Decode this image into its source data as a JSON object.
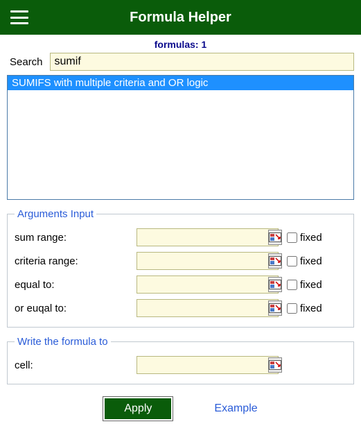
{
  "header": {
    "title": "Formula Helper"
  },
  "subheader": {
    "text": "formulas: 1"
  },
  "search": {
    "label": "Search",
    "value": "sumif"
  },
  "results": [
    {
      "label": "SUMIFS with multiple criteria and OR logic"
    }
  ],
  "arguments": {
    "legend": "Arguments Input",
    "rows": [
      {
        "label": "sum range:",
        "value": "",
        "fixed_label": "fixed",
        "has_fixed": true
      },
      {
        "label": "criteria range:",
        "value": "",
        "fixed_label": "fixed",
        "has_fixed": true
      },
      {
        "label": "equal to:",
        "value": "",
        "fixed_label": "fixed",
        "has_fixed": true
      },
      {
        "label": "or euqal to:",
        "value": "",
        "fixed_label": "fixed",
        "has_fixed": true
      }
    ]
  },
  "output": {
    "legend": "Write the formula to",
    "row": {
      "label": "cell:",
      "value": ""
    }
  },
  "buttons": {
    "apply": "Apply",
    "example": "Example"
  }
}
